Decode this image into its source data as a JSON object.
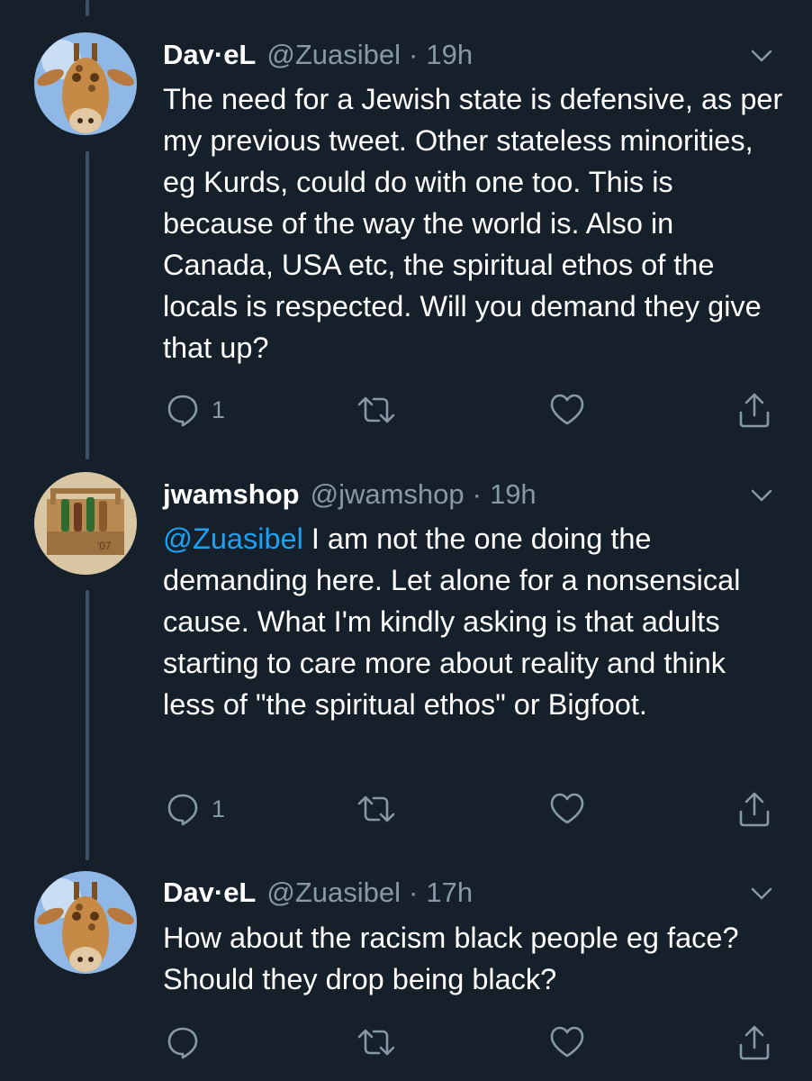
{
  "tweets": [
    {
      "name": "Dav·eL",
      "handle": "@Zuasibel",
      "separator": "·",
      "time": "19h",
      "avatar": "giraffe-avatar",
      "mention": "",
      "text": "The need for a Jewish state is defensive, as per my previous tweet. Other stateless minorities, eg Kurds, could do with one too. This is because of the way the world is. Also in Canada, USA etc, the spiritual ethos of the locals is respected. Will you demand they give that up?",
      "reply_count": "1"
    },
    {
      "name": "jwamshop",
      "handle": "@jwamshop",
      "separator": "·",
      "time": "19h",
      "avatar": "bottle-crate-avatar",
      "mention": "@Zuasibel",
      "text": " I am not the one doing the demanding here. Let alone for a nonsensical cause. What I'm kindly asking is that adults starting to care more about reality and think less of \"the spiritual ethos\" or Bigfoot.",
      "reply_count": "1"
    },
    {
      "name": "Dav·eL",
      "handle": "@Zuasibel",
      "separator": "·",
      "time": "17h",
      "avatar": "giraffe-avatar",
      "mention": "",
      "text": "How about the racism black people eg face? Should they drop being black?",
      "reply_count": ""
    }
  ],
  "colors": {
    "background": "#15202b",
    "text": "#ffffff",
    "secondary": "#8899a6",
    "link": "#1da1f2",
    "thread_line": "#3d5466"
  }
}
